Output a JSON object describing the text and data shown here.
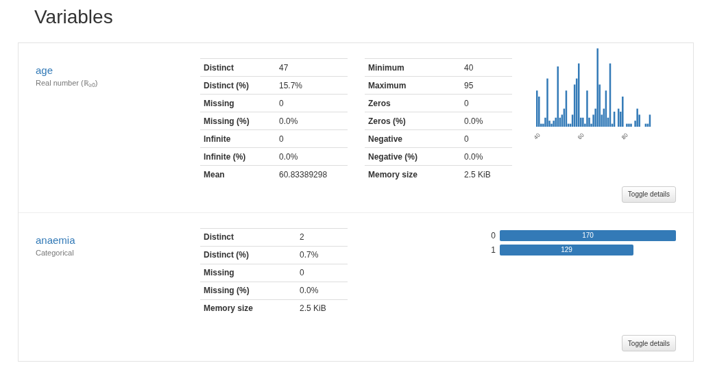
{
  "title": "Variables",
  "variables": [
    {
      "kind": "numeric",
      "name": "age",
      "type": "Real number (ℝ$_{≥0}$)",
      "tables": [
        [
          {
            "label": "Distinct",
            "value": "47"
          },
          {
            "label": "Distinct (%)",
            "value": "15.7%"
          },
          {
            "label": "Missing",
            "value": "0"
          },
          {
            "label": "Missing (%)",
            "value": "0.0%"
          },
          {
            "label": "Infinite",
            "value": "0"
          },
          {
            "label": "Infinite (%)",
            "value": "0.0%"
          },
          {
            "label": "Mean",
            "value": "60.83389298"
          }
        ],
        [
          {
            "label": "Minimum",
            "value": "40"
          },
          {
            "label": "Maximum",
            "value": "95"
          },
          {
            "label": "Zeros",
            "value": "0"
          },
          {
            "label": "Zeros (%)",
            "value": "0.0%"
          },
          {
            "label": "Negative",
            "value": "0"
          },
          {
            "label": "Negative (%)",
            "value": "0.0%"
          },
          {
            "label": "Memory size",
            "value": "2.5 KiB"
          }
        ]
      ],
      "histogram_ticks": [
        "40",
        "60",
        "80"
      ],
      "button": "Toggle details"
    },
    {
      "kind": "categorical",
      "name": "anaemia",
      "type": "Categorical",
      "tables": [
        [
          {
            "label": "Distinct",
            "value": "2"
          },
          {
            "label": "Distinct (%)",
            "value": "0.7%"
          },
          {
            "label": "Missing",
            "value": "0"
          },
          {
            "label": "Missing (%)",
            "value": "0.0%"
          },
          {
            "label": "Memory size",
            "value": "2.5 KiB"
          }
        ]
      ],
      "categories": [
        {
          "label": "0",
          "count": "170",
          "level": 1
        },
        {
          "label": "1",
          "count": "129",
          "level": 0.759
        }
      ],
      "button": "Toggle details"
    }
  ]
}
